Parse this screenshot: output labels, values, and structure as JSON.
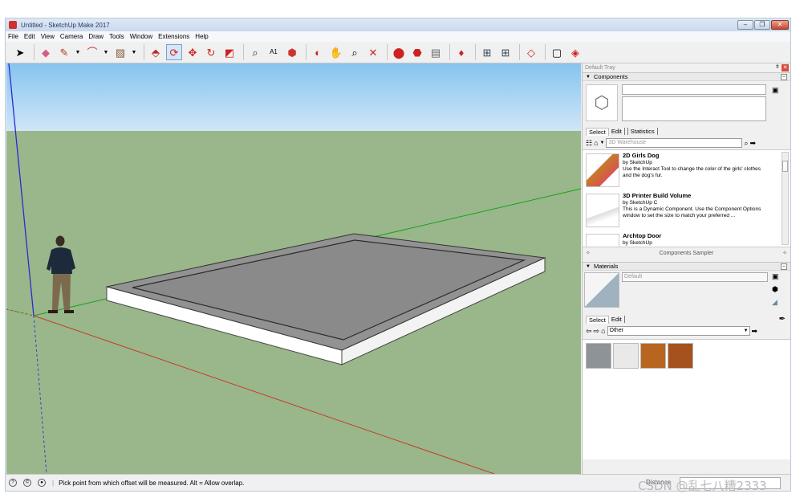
{
  "window": {
    "title": "Untitled - SketchUp Make 2017",
    "controls": [
      "–",
      "❐",
      "✕"
    ]
  },
  "menu": [
    "File",
    "Edit",
    "View",
    "Camera",
    "Draw",
    "Tools",
    "Window",
    "Extensions",
    "Help"
  ],
  "toolbar_icons": [
    "select-icon",
    "eraser-icon",
    "pencil-icon",
    "arc-icon",
    "shape-icon",
    "pushpull-icon",
    "offset-icon",
    "move-icon",
    "rotate-icon",
    "scale-icon",
    "tape-measure-icon",
    "text-icon",
    "paint-bucket-icon",
    "orbit-icon",
    "pan-icon",
    "zoom-icon",
    "zoom-extents-icon",
    "warehouse-icon",
    "extension-warehouse-icon",
    "layout-icon",
    "ruby-icon",
    "components-icon",
    "groups-icon",
    "section-icon",
    "box-icon",
    "styles-icon"
  ],
  "tray": {
    "title": "Default Tray",
    "components": {
      "header": "Components",
      "tabs": [
        "Select",
        "Edit",
        "Statistics"
      ],
      "search_placeholder": "3D Warehouse",
      "items": [
        {
          "name": "2D Girls Dog",
          "by": "by SketchUp",
          "desc": "Use the Interact Tool to change the color of the girls' clothes and the dog's fur."
        },
        {
          "name": "3D Printer Build Volume",
          "by": "by SketchUp C",
          "desc": "This is a Dynamic Component. Use the Component Options window to set the size to match your preferred ..."
        },
        {
          "name": "Archtop Door",
          "by": "by SketchUp",
          "desc": ""
        }
      ],
      "footer": "Components Sampler"
    },
    "materials": {
      "header": "Materials",
      "current": "Default",
      "tabs": [
        "Select",
        "Edit"
      ],
      "collection": "Other",
      "swatches": [
        "#8d9396",
        "#e9e9e9",
        "#b8651f",
        "#a5521c"
      ]
    }
  },
  "status": {
    "message": "Pick point from which offset will be measured. Alt = Allow overlap.",
    "measure_label": "Distance"
  },
  "watermark": "CSDN @乱七八糟2333",
  "scene_colors": {
    "sky": "#a9d4f2",
    "ground": "#99b78a",
    "slab_top": "#8f8f8f",
    "slab_side": "#ffffff"
  }
}
